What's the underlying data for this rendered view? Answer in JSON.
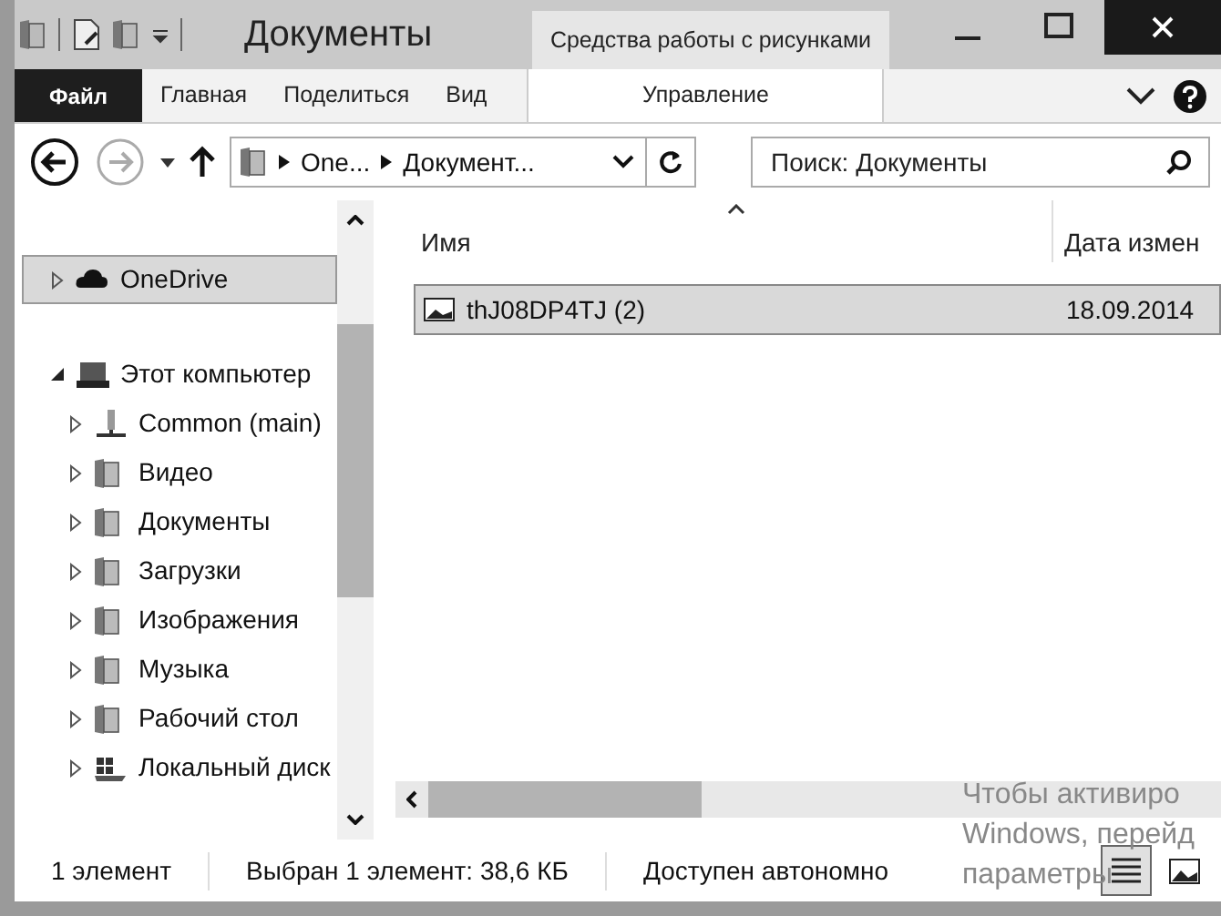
{
  "window": {
    "title": "Документы",
    "context_tab": "Средства работы с рисунками"
  },
  "ribbon_tabs": [
    {
      "label": "Файл",
      "kind": "file",
      "selected": false
    },
    {
      "label": "Главная",
      "kind": "tab",
      "selected": false
    },
    {
      "label": "Поделиться",
      "kind": "tab",
      "selected": false
    },
    {
      "label": "Вид",
      "kind": "tab",
      "selected": false
    },
    {
      "label": "Управление",
      "kind": "context",
      "selected": false
    }
  ],
  "address": {
    "segments": [
      "One...",
      "Документ..."
    ]
  },
  "search": {
    "placeholder": "Поиск: Документы"
  },
  "sidebar": {
    "items": [
      {
        "label": "OneDrive",
        "kind": "cloud",
        "expanded": false,
        "selected": true
      },
      {
        "label": "Этот компьютер",
        "kind": "computer",
        "expanded": true,
        "selected": false,
        "children": [
          {
            "label": "Common (main)",
            "kind": "network",
            "expanded": false,
            "selected": false
          },
          {
            "label": "Видео",
            "kind": "folder",
            "expanded": false,
            "selected": false
          },
          {
            "label": "Документы",
            "kind": "folder",
            "expanded": false,
            "selected": false
          },
          {
            "label": "Загрузки",
            "kind": "folder",
            "expanded": false,
            "selected": false
          },
          {
            "label": "Изображения",
            "kind": "folder",
            "expanded": false,
            "selected": false
          },
          {
            "label": "Музыка",
            "kind": "folder",
            "expanded": false,
            "selected": false
          },
          {
            "label": "Рабочий стол",
            "kind": "folder",
            "expanded": false,
            "selected": false
          },
          {
            "label": "Локальный диск",
            "kind": "drive",
            "expanded": false,
            "selected": false
          }
        ]
      }
    ]
  },
  "table": {
    "columns": [
      "Имя",
      "Дата измен"
    ],
    "rows": [
      {
        "name": "thJ08DP4TJ (2)",
        "date": "18.09.2014",
        "selected": true
      }
    ]
  },
  "activation_notice": [
    "Чтобы активиро",
    "Windows, перейд",
    "параметры"
  ],
  "status_bar": [
    "1 элемент",
    "Выбран 1 элемент: 38,6 КБ",
    "Доступен автономно"
  ],
  "views": [
    {
      "kind": "details",
      "selected": true
    },
    {
      "kind": "thumbnails",
      "selected": false
    }
  ]
}
